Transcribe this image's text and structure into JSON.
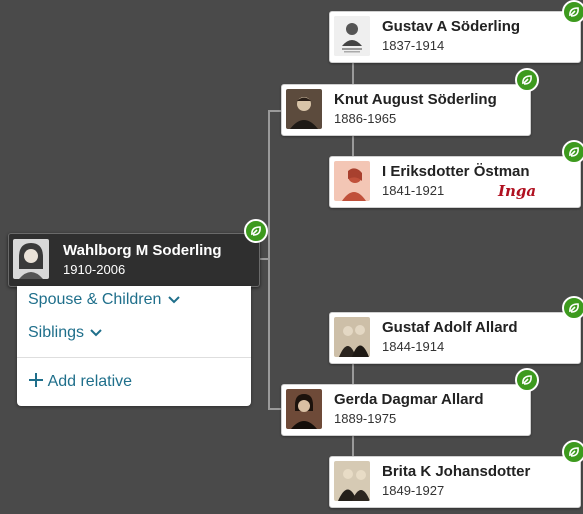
{
  "focus_person": {
    "name": "Wahlborg M Soderling",
    "dates": "1910-2006"
  },
  "menu": {
    "spouse_children": "Spouse & Children",
    "siblings": "Siblings",
    "add_relative": "Add relative"
  },
  "people": {
    "father": {
      "name": "Knut August Söderling",
      "dates": "1886-1965"
    },
    "mother": {
      "name": "Gerda Dagmar  Allard",
      "dates": "1889-1975"
    },
    "pat_grandfather": {
      "name": "Gustav A Söderling",
      "dates": "1837-1914"
    },
    "pat_grandmother": {
      "name": "I Eriksdotter Östman",
      "dates": "1841-1921"
    },
    "mat_grandfather": {
      "name": "Gustaf Adolf Allard",
      "dates": "1844-1914"
    },
    "mat_grandmother": {
      "name": "Brita K   Johansdotter",
      "dates": "1849-1927"
    }
  },
  "annotation": {
    "handwritten_note": "Inga"
  },
  "colors": {
    "background": "#4a4a4a",
    "hint_green": "#3d9a1e",
    "link_teal": "#1f6f8b",
    "focus_card": "#2f2f2f"
  }
}
